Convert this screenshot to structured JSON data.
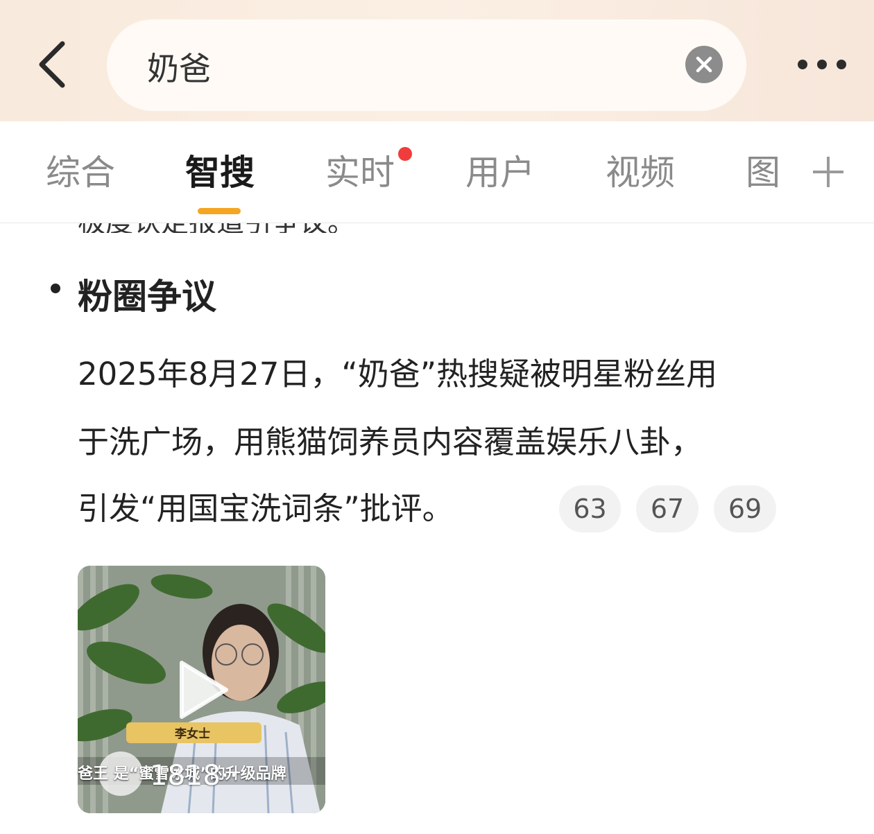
{
  "search": {
    "query": "奶爸",
    "placeholder": ""
  },
  "tabs": [
    {
      "label": "综合"
    },
    {
      "label": "智搜"
    },
    {
      "label": "实时"
    },
    {
      "label": "用户"
    },
    {
      "label": "视频"
    },
    {
      "label": "图"
    }
  ],
  "active_tab": "智搜",
  "accent_color": "#f5a521",
  "notification_dot_color": "#f03c3c",
  "content": {
    "partial_line": "极度认定报道引争议。",
    "section_title": "粉圈争议",
    "paragraph_lines": [
      "2025年8月27日，“奶爸”热搜疑被明星粉丝用",
      "于洗广场，用熊猫饲养员内容覆盖娱乐八卦，",
      "引发“用国宝洗词条”批评。"
    ],
    "citations": [
      "63",
      "67",
      "69"
    ]
  },
  "video": {
    "play_count": "1818··",
    "caption_name": "李女士",
    "caption_sub": "爸王 是“蜜雪冰城”的升级品牌"
  },
  "icons": {
    "back": "chevron-left-icon",
    "clear": "close-icon",
    "more": "more-horizontal-icon",
    "plus": "plus-icon",
    "play": "play-icon"
  }
}
